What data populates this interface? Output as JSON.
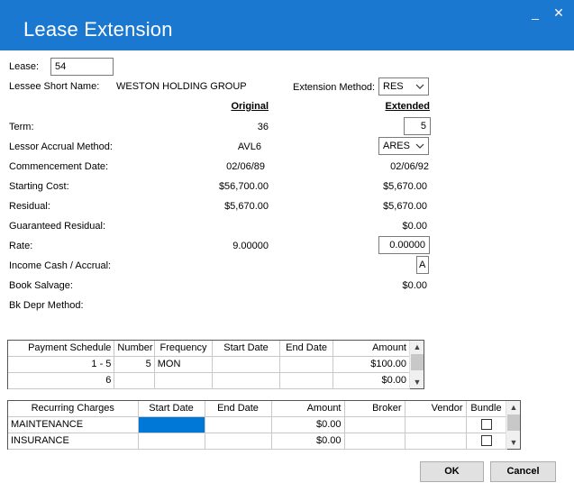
{
  "window": {
    "title": "Lease Extension",
    "minimize_glyph": "_",
    "close_glyph": "✕"
  },
  "lease": {
    "label": "Lease:",
    "value": "54"
  },
  "lessee": {
    "label": "Lessee Short Name:",
    "value": "WESTON HOLDING GROUP"
  },
  "extension_method": {
    "label": "Extension Method:",
    "value": "RES"
  },
  "columns": {
    "original": "Original",
    "extended": "Extended"
  },
  "fields": {
    "term": {
      "label": "Term:",
      "original": "36",
      "extended": "5"
    },
    "accrual": {
      "label": "Lessor Accrual Method:",
      "original": "AVL6",
      "extended": "ARES"
    },
    "commencement": {
      "label": "Commencement Date:",
      "original": "02/06/89",
      "extended": "02/06/92"
    },
    "starting_cost": {
      "label": "Starting Cost:",
      "original": "$56,700.00",
      "extended": "$5,670.00"
    },
    "residual": {
      "label": "Residual:",
      "original": "$5,670.00",
      "extended": "$5,670.00"
    },
    "guaranteed_residual": {
      "label": "Guaranteed Residual:",
      "extended": "$0.00"
    },
    "rate": {
      "label": "Rate:",
      "original": "9.00000",
      "extended": "0.00000"
    },
    "income_cash": {
      "label": "Income Cash / Accrual:",
      "extended": "A"
    },
    "book_salvage": {
      "label": "Book Salvage:",
      "extended": "$0.00"
    },
    "bk_depr": {
      "label": "Bk Depr Method:"
    }
  },
  "payment_schedule": {
    "headers": [
      "Payment Schedule",
      "Number",
      "Frequency",
      "Start Date",
      "End Date",
      "Amount"
    ],
    "rows": [
      [
        "1 -  5",
        "5",
        "MON",
        "",
        "",
        "$100.00"
      ],
      [
        "6",
        "",
        "",
        "",
        "",
        "$0.00"
      ]
    ]
  },
  "recurring_charges": {
    "headers": [
      "Recurring Charges",
      "Start Date",
      "End Date",
      "Amount",
      "Broker",
      "Vendor",
      "Bundle"
    ],
    "rows": [
      [
        "MAINTENANCE",
        "",
        "",
        "$0.00",
        "",
        "",
        ""
      ],
      [
        "INSURANCE",
        "",
        "",
        "$0.00",
        "",
        "",
        ""
      ]
    ]
  },
  "buttons": {
    "ok": "OK",
    "cancel": "Cancel"
  },
  "colors": {
    "titlebar": "#1b78d0",
    "selection": "#0078d7"
  }
}
